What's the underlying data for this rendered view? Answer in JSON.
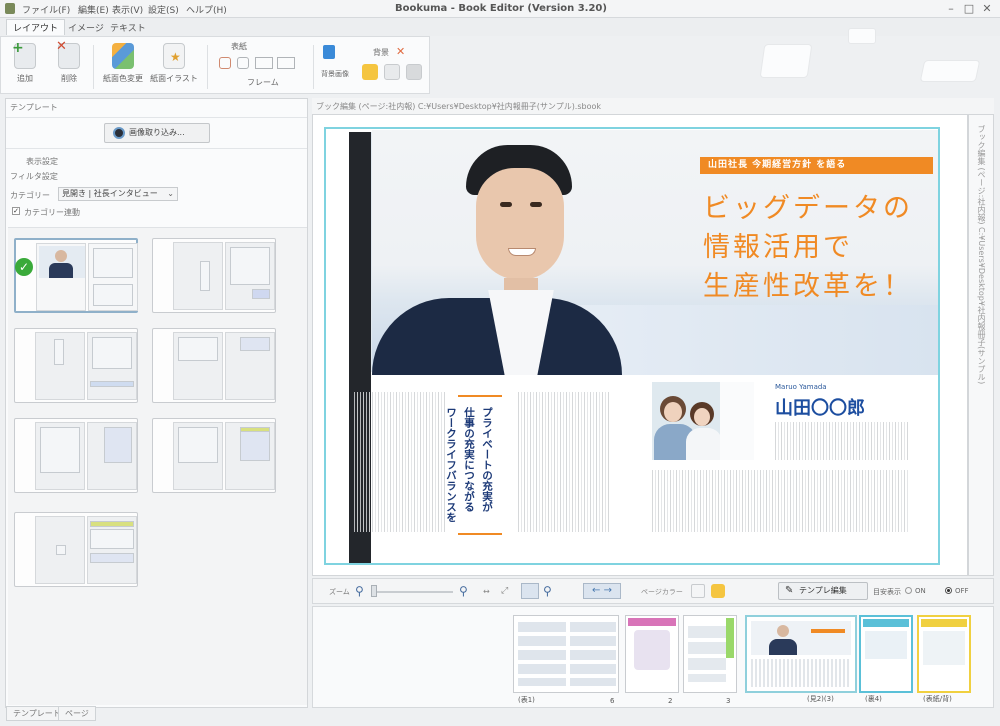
{
  "window": {
    "title": "Bookuma - Book Editor  (Version 3.20)",
    "menu": [
      "ファイル(F)",
      "編集(E)",
      "表示(V)",
      "設定(S)",
      "ヘルプ(H)"
    ]
  },
  "ribbon": {
    "tabs": [
      "レイアウト",
      "イメージ",
      "テキスト"
    ],
    "active_tab": "レイアウト",
    "buttons": {
      "add": "追加",
      "delete": "削除",
      "change_layout": "紙面色変更",
      "illustration": "紙面イラスト",
      "frame_group": "フレーム",
      "frame_top": "表紙",
      "background": "背景画像",
      "color": "背景"
    }
  },
  "left_panel": {
    "header": "テンプレート",
    "import_button": "画像取り込み...",
    "display_settings": "表示設定",
    "filter_label": "フィルタ設定",
    "category_label": "カテゴリー",
    "category_value": "見開き | 社長インタビュー",
    "category_check": "カテゴリー連動",
    "bottom_tabs": [
      "テンプレート",
      "ページ"
    ]
  },
  "editor": {
    "header": "ブック編集 (ページ:社内報)   C:¥Users¥Desktop¥社内報冊子(サンプル).sbook",
    "side_vertical": "ブック編集 (ページ:社内報) C:¥Users¥Desktop¥社内報冊子(サンプル)",
    "spread": {
      "banner": "山田社長 今期経営方針 を語る",
      "headline": [
        "ビッグデータの",
        "情報活用で",
        "生産性改革を！"
      ],
      "vertical_title": "プライベートの充実が 仕事の充実につながる ワークライフバランスを",
      "name_romaji": "Maruo Yamada",
      "name": "山田〇〇郎"
    }
  },
  "toolbar": {
    "zoom_label": "ズーム",
    "page_color_label": "ページカラー",
    "template_edit": "テンプレ編集",
    "guide_display": "目安表示",
    "on": "ON",
    "off": "OFF"
  },
  "thumbnails": {
    "labels": [
      "(表1)",
      "6",
      "2",
      "3",
      "(見2)(3)",
      "(裏4)",
      "(表紙/背)"
    ]
  },
  "colors": {
    "accent": "#f08a24",
    "selection": "#7fd3e0",
    "navy": "#1d3a78"
  }
}
